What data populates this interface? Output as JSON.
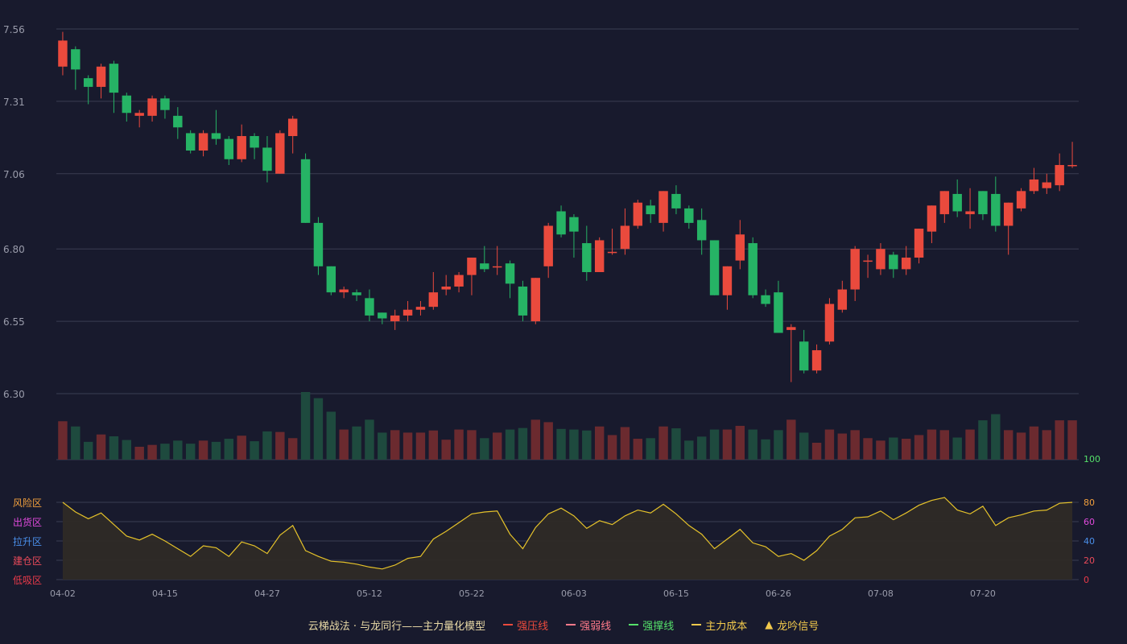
{
  "colors": {
    "background": "#181a2d",
    "up": "#ea4a3d",
    "down": "#26b365",
    "up_volume": "#6b2a2f",
    "down_volume": "#1e4a3e",
    "grid": "#3a3d52",
    "axis_text": "#9a9cab",
    "indicator_line": "#e5c22a",
    "indicator_fill": "#2e2a26",
    "title_text": "#e8d9a6"
  },
  "legend": {
    "title": "云梯战法 · 与龙同行——主力量化模型",
    "items": [
      {
        "label": "强压线",
        "color": "#ea4a3d",
        "style": "solid"
      },
      {
        "label": "强弱线",
        "color": "#ff7a8a",
        "style": "dashed"
      },
      {
        "label": "强撑线",
        "color": "#55e06a",
        "style": "solid"
      },
      {
        "label": "主力成本",
        "color": "#f2c94c",
        "style": "dashed"
      },
      {
        "label": "龙吟信号",
        "color": "#f2c94c",
        "style": "triangle"
      }
    ]
  },
  "chart_data": [
    {
      "type": "candlestick",
      "ylim": [
        6.3,
        7.56
      ],
      "yticks": [
        "7.56",
        "7.31",
        "7.06",
        "6.80",
        "6.55",
        "6.30"
      ],
      "x_tick_labels": [
        {
          "index": 0,
          "label": "04-02"
        },
        {
          "index": 8,
          "label": "04-15"
        },
        {
          "index": 16,
          "label": "04-27"
        },
        {
          "index": 24,
          "label": "05-12"
        },
        {
          "index": 32,
          "label": "05-22"
        },
        {
          "index": 40,
          "label": "06-03"
        },
        {
          "index": 48,
          "label": "06-15"
        },
        {
          "index": 56,
          "label": "06-26"
        },
        {
          "index": 64,
          "label": "07-08"
        },
        {
          "index": 72,
          "label": "07-20"
        }
      ],
      "ohlc": [
        [
          7.43,
          7.52,
          7.4,
          7.55
        ],
        [
          7.49,
          7.42,
          7.35,
          7.5
        ],
        [
          7.39,
          7.36,
          7.3,
          7.4
        ],
        [
          7.36,
          7.43,
          7.32,
          7.44
        ],
        [
          7.44,
          7.34,
          7.27,
          7.45
        ],
        [
          7.33,
          7.27,
          7.24,
          7.34
        ],
        [
          7.26,
          7.27,
          7.22,
          7.28
        ],
        [
          7.26,
          7.32,
          7.24,
          7.33
        ],
        [
          7.32,
          7.28,
          7.25,
          7.33
        ],
        [
          7.26,
          7.22,
          7.18,
          7.29
        ],
        [
          7.2,
          7.14,
          7.13,
          7.21
        ],
        [
          7.14,
          7.2,
          7.12,
          7.21
        ],
        [
          7.2,
          7.18,
          7.16,
          7.28
        ],
        [
          7.18,
          7.11,
          7.09,
          7.19
        ],
        [
          7.11,
          7.19,
          7.1,
          7.23
        ],
        [
          7.19,
          7.15,
          7.11,
          7.2
        ],
        [
          7.15,
          7.07,
          7.03,
          7.19
        ],
        [
          7.06,
          7.2,
          7.06,
          7.21
        ],
        [
          7.19,
          7.25,
          7.13,
          7.26
        ],
        [
          7.11,
          6.89,
          6.89,
          7.13
        ],
        [
          6.89,
          6.74,
          6.71,
          6.91
        ],
        [
          6.74,
          6.65,
          6.64,
          6.74
        ],
        [
          6.65,
          6.66,
          6.63,
          6.67
        ],
        [
          6.65,
          6.64,
          6.62,
          6.66
        ],
        [
          6.63,
          6.57,
          6.55,
          6.66
        ],
        [
          6.58,
          6.56,
          6.54,
          6.58
        ],
        [
          6.55,
          6.57,
          6.52,
          6.59
        ],
        [
          6.57,
          6.59,
          6.55,
          6.62
        ],
        [
          6.59,
          6.6,
          6.57,
          6.62
        ],
        [
          6.6,
          6.65,
          6.59,
          6.72
        ],
        [
          6.66,
          6.67,
          6.64,
          6.71
        ],
        [
          6.67,
          6.71,
          6.65,
          6.72
        ],
        [
          6.71,
          6.77,
          6.64,
          6.77
        ],
        [
          6.75,
          6.73,
          6.72,
          6.81
        ],
        [
          6.74,
          6.74,
          6.71,
          6.81
        ],
        [
          6.75,
          6.68,
          6.63,
          6.76
        ],
        [
          6.67,
          6.57,
          6.55,
          6.69
        ],
        [
          6.55,
          6.7,
          6.54,
          6.7
        ],
        [
          6.74,
          6.88,
          6.7,
          6.89
        ],
        [
          6.93,
          6.85,
          6.84,
          6.95
        ],
        [
          6.91,
          6.86,
          6.77,
          6.92
        ],
        [
          6.82,
          6.72,
          6.69,
          6.88
        ],
        [
          6.72,
          6.83,
          6.72,
          6.84
        ],
        [
          6.79,
          6.79,
          6.78,
          6.87
        ],
        [
          6.8,
          6.88,
          6.78,
          6.94
        ],
        [
          6.88,
          6.96,
          6.87,
          6.97
        ],
        [
          6.95,
          6.92,
          6.89,
          6.97
        ],
        [
          6.89,
          7.0,
          6.86,
          7.0
        ],
        [
          6.99,
          6.94,
          6.92,
          7.02
        ],
        [
          6.94,
          6.89,
          6.87,
          6.95
        ],
        [
          6.9,
          6.83,
          6.78,
          6.94
        ],
        [
          6.83,
          6.64,
          6.64,
          6.83
        ],
        [
          6.64,
          6.74,
          6.59,
          6.74
        ],
        [
          6.76,
          6.85,
          6.73,
          6.9
        ],
        [
          6.82,
          6.64,
          6.63,
          6.84
        ],
        [
          6.64,
          6.61,
          6.6,
          6.66
        ],
        [
          6.65,
          6.51,
          6.51,
          6.69
        ],
        [
          6.52,
          6.53,
          6.34,
          6.54
        ],
        [
          6.48,
          6.38,
          6.37,
          6.52
        ],
        [
          6.38,
          6.45,
          6.37,
          6.47
        ],
        [
          6.48,
          6.61,
          6.47,
          6.63
        ],
        [
          6.59,
          6.66,
          6.58,
          6.69
        ],
        [
          6.66,
          6.8,
          6.62,
          6.81
        ],
        [
          6.76,
          6.76,
          6.7,
          6.78
        ],
        [
          6.73,
          6.8,
          6.71,
          6.82
        ],
        [
          6.78,
          6.73,
          6.7,
          6.79
        ],
        [
          6.73,
          6.77,
          6.71,
          6.81
        ],
        [
          6.77,
          6.87,
          6.75,
          6.87
        ],
        [
          6.86,
          6.95,
          6.82,
          6.95
        ],
        [
          6.92,
          7.0,
          6.89,
          7.0
        ],
        [
          6.99,
          6.93,
          6.91,
          7.04
        ],
        [
          6.92,
          6.93,
          6.87,
          7.01
        ],
        [
          7.0,
          6.92,
          6.9,
          7.0
        ],
        [
          6.99,
          6.88,
          6.86,
          7.05
        ],
        [
          6.88,
          6.96,
          6.78,
          6.96
        ],
        [
          6.94,
          7.0,
          6.93,
          7.01
        ],
        [
          7.0,
          7.04,
          6.99,
          7.08
        ],
        [
          7.01,
          7.03,
          6.99,
          7.06
        ],
        [
          7.02,
          7.09,
          7.0,
          7.13
        ],
        [
          7.09,
          7.09,
          7.08,
          7.17
        ]
      ]
    },
    {
      "type": "bar",
      "values": [
        125,
        108,
        58,
        82,
        76,
        64,
        42,
        48,
        52,
        62,
        52,
        62,
        58,
        68,
        78,
        60,
        92,
        90,
        70,
        220,
        200,
        156,
        98,
        108,
        130,
        88,
        96,
        88,
        88,
        95,
        65,
        98,
        96,
        70,
        88,
        98,
        103,
        130,
        122,
        100,
        98,
        95,
        108,
        80,
        106,
        68,
        70,
        108,
        102,
        62,
        75,
        98,
        98,
        110,
        98,
        66,
        96,
        130,
        88,
        55,
        98,
        85,
        96,
        70,
        62,
        72,
        68,
        80,
        98,
        96,
        72,
        98,
        128,
        148,
        96,
        88,
        108,
        96,
        128,
        128
      ],
      "ylim": [
        0,
        220
      ],
      "ytick": "100"
    },
    {
      "type": "area",
      "values": [
        80,
        70,
        63,
        69,
        57,
        45,
        41,
        47,
        40,
        32,
        24,
        35,
        33,
        24,
        39,
        35,
        27,
        46,
        56,
        30,
        24,
        19,
        18,
        16,
        13,
        11,
        15,
        22,
        24,
        42,
        50,
        59,
        68,
        70,
        71,
        47,
        32,
        54,
        68,
        74,
        66,
        53,
        61,
        57,
        66,
        72,
        69,
        78,
        68,
        56,
        47,
        32,
        42,
        52,
        38,
        34,
        24,
        27,
        20,
        30,
        45,
        52,
        64,
        65,
        71,
        62,
        69,
        77,
        82,
        85,
        72,
        68,
        76,
        56,
        64,
        67,
        71,
        72,
        79,
        80
      ],
      "ylim": [
        0,
        100
      ],
      "yticks": [
        "80",
        "60",
        "40",
        "20",
        "0"
      ],
      "zone_labels": [
        {
          "label": "风险区",
          "color": "#f2a03d"
        },
        {
          "label": "出货区",
          "color": "#e04adc"
        },
        {
          "label": "拉升区",
          "color": "#4a8fea"
        },
        {
          "label": "建仓区",
          "color": "#ea4a5a"
        },
        {
          "label": "低吸区",
          "color": "#ea3a4a"
        }
      ],
      "ytick_colors": [
        "#f2a03d",
        "#e04adc",
        "#4a8fea",
        "#ea4a5a",
        "#ea3a4a"
      ]
    }
  ]
}
